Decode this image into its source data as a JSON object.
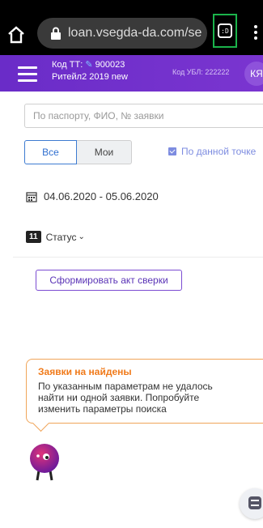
{
  "browser": {
    "url": "loan.vsegda-da.com/se",
    "tabs_glyph": ":D"
  },
  "header": {
    "kod_tt_label": "Код ТТ:",
    "kod_tt_value": "900023",
    "shop_name": "Ритейл2 2019 new",
    "ubl": "Код УБЛ: 222222",
    "avatar_initials": "КЯ"
  },
  "filters": {
    "search_placeholder": "По паспорту, ФИО, № заявки",
    "all_label": "Все",
    "mine_label": "Мои",
    "point_label": "По данной точке",
    "date_range": "04.06.2020 - 05.06.2020",
    "status_count": "11",
    "status_label": "Статус"
  },
  "actions": {
    "act_button": "Сформировать акт сверки"
  },
  "empty_state": {
    "title": "Заявки на найдены",
    "message": "По указанным параметрам не удалось найти ни одной заявки. Попробуйте изменить параметры поиска"
  },
  "colors": {
    "brand": "#6a2cc8",
    "accent_orange": "#f07a1a",
    "link_blue": "#2f6fd0"
  }
}
